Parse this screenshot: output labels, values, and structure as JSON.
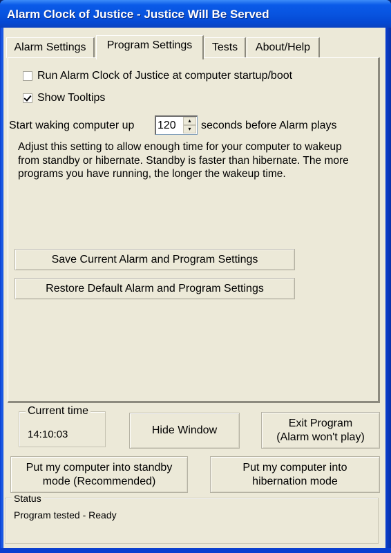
{
  "window": {
    "title": "Alarm Clock of Justice - Justice Will Be Served"
  },
  "tabs": [
    {
      "label": "Alarm Settings",
      "active": false
    },
    {
      "label": "Program Settings",
      "active": true
    },
    {
      "label": "Tests",
      "active": false
    },
    {
      "label": "About/Help",
      "active": false
    }
  ],
  "program_settings": {
    "run_at_startup": {
      "label": "Run Alarm Clock of Justice at computer startup/boot",
      "checked": false
    },
    "show_tooltips": {
      "label": "Show Tooltips",
      "checked": true
    },
    "wake_prefix": "Start waking computer up",
    "wake_seconds": "120",
    "wake_suffix": "seconds before Alarm plays",
    "description": "Adjust this setting to allow enough time for your computer to wakeup from standby or hibernate.  Standby is faster than hibernate.  The more programs you have running, the longer the wakeup time.",
    "save_button": "Save Current Alarm and Program Settings",
    "restore_button": "Restore Default Alarm and Program Settings"
  },
  "current_time": {
    "label": "Current time",
    "value": "14:10:03"
  },
  "buttons": {
    "hide_window": "Hide Window",
    "exit_line1": "Exit Program",
    "exit_line2": "(Alarm won't play)",
    "standby_line1": "Put my computer into standby",
    "standby_line2": "mode (Recommended)",
    "hibernate_line1": "Put my computer into",
    "hibernate_line2": "hibernation mode"
  },
  "status": {
    "label": "Status",
    "text": "Program tested - Ready"
  },
  "icons": {
    "spin_up": "▴",
    "spin_down": "▾"
  }
}
